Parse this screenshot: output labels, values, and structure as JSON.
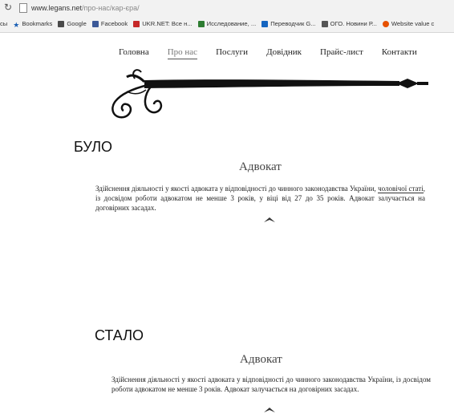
{
  "browser": {
    "url_host": "www.legans.net",
    "url_path": "/про-нас/кар-єра/",
    "bookmarks_prefix": "сы",
    "bookmarks": [
      {
        "label": "Bookmarks",
        "icon": "star-icon",
        "color": "#1a5fb4"
      },
      {
        "label": "Google",
        "icon": "google-icon",
        "color": "#4a4a4a"
      },
      {
        "label": "Facebook",
        "icon": "facebook-icon",
        "color": "#3b5998"
      },
      {
        "label": "UKR.NET: Все н...",
        "icon": "ukrnet-icon",
        "color": "#c62828"
      },
      {
        "label": "Исследование, ...",
        "icon": "research-icon",
        "color": "#2e7d32"
      },
      {
        "label": "Переводчик G...",
        "icon": "translate-icon",
        "color": "#1565c0"
      },
      {
        "label": "ОГО. Новини Р...",
        "icon": "ogo-icon",
        "color": "#555555"
      },
      {
        "label": "Website value c",
        "icon": "website-value-icon",
        "color": "#e65100"
      }
    ]
  },
  "nav": {
    "items": [
      "Головна",
      "Про нас",
      "Послуги",
      "Довідник",
      "Прайс-лист",
      "Контакти"
    ],
    "active_index": 1
  },
  "before": {
    "label": "БУЛО",
    "title": "Адвокат",
    "text_start": "Здійснення діяльності у якості адвоката у відповідності до чинного законодавства України, ",
    "text_underlined": "чоловічої статі",
    "text_end": ", із досвідом роботи адвокатом не менше 3 років, у віці від 27 до 35 років. Адвокат залучається на договірних засадах."
  },
  "after": {
    "label": "СТАЛО",
    "title": "Адвокат",
    "text": "Здійснення діяльності у якості адвоката у відповідності до чинного законодавства України, із досвідом роботи адвокатом не менше 3 років. Адвокат залучається на договірних засадах."
  }
}
